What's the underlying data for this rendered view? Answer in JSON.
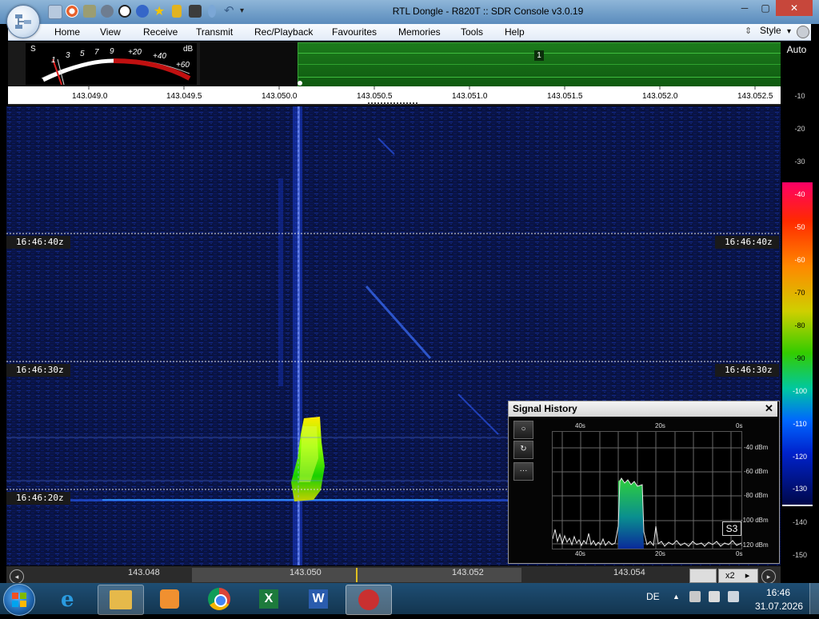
{
  "window": {
    "title": "RTL Dongle - R820T :: SDR Console v3.0.19",
    "minimize": "─",
    "maximize": "▢",
    "close": "✕"
  },
  "quick_access_icons": [
    "home-icon",
    "lifebuoy-icon",
    "folder-icon",
    "play-icon",
    "stop-icon",
    "add-icon",
    "favourite-star-icon",
    "lock-icon",
    "camera-icon",
    "drop-icon",
    "undo-icon",
    "dropdown-icon"
  ],
  "menu": {
    "items": [
      "Home",
      "View",
      "Receive",
      "Transmit",
      "Rec/Playback",
      "Favourites",
      "Memories",
      "Tools",
      "Help"
    ],
    "style_label": "Style",
    "style_arrow": "▾"
  },
  "smeter": {
    "s_label": "S",
    "db_label": "dB",
    "s_scale": [
      "1",
      "3",
      "5",
      "7",
      "9"
    ],
    "db_scale": [
      "+20",
      "+40",
      "+60"
    ]
  },
  "mini_spectrum": {
    "marker": "1"
  },
  "frequency_scale": {
    "labels": [
      "143.049.0",
      "143.049.5",
      "143.050.0",
      "143.050.5",
      "143.051.0",
      "143.051.5",
      "143.052.0",
      "143.052.5"
    ]
  },
  "waterfall": {
    "time_marks": [
      {
        "left": "16:46:40z",
        "right": "16:46:40z"
      },
      {
        "left": "16:46:30z",
        "right": "16:46:30z"
      },
      {
        "left": "16:46:20z",
        "right": ""
      }
    ]
  },
  "level_scale": {
    "auto": "Auto",
    "ticks": [
      "-10",
      "-20",
      "-30",
      "-40",
      "-50",
      "-60",
      "-70",
      "-80",
      "-90",
      "-100",
      "-110",
      "-120",
      "-130",
      "-140",
      "-150"
    ]
  },
  "bottom_bar": {
    "freqs": [
      "143.048",
      "143.050",
      "143.052",
      "143.054"
    ],
    "zoom": "x2",
    "zoom_arrow": "▸"
  },
  "signal_history": {
    "title": "Signal History",
    "close": "✕",
    "time_top": [
      "40s",
      "20s",
      "0s"
    ],
    "time_bottom": [
      "40s",
      "20s",
      "0s"
    ],
    "dbm_labels": [
      "-40 dBm",
      "-60 dBm",
      "-80 dBm",
      "-100 dBm",
      "-120 dBm"
    ],
    "s_reading": "S3",
    "tools": [
      "○",
      "↻",
      "···"
    ]
  },
  "taskbar": {
    "language": "DE",
    "time": "16:46",
    "date": "31.07.2026",
    "apps": [
      "explorer",
      "internet-explorer",
      "media-player",
      "chrome",
      "excel",
      "word",
      "sdr-console"
    ],
    "tray_arrow": "▲"
  },
  "colors": {
    "waterfall_bg": "#0a1440",
    "titlebar": "#6e9cc7",
    "menubar": "#e4ecf7",
    "spectrum_green": "#1c7b1c"
  }
}
